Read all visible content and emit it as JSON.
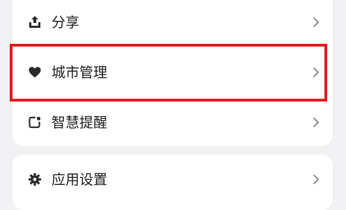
{
  "menu_group_1": {
    "items": [
      {
        "label": "分享",
        "icon": "share-icon"
      },
      {
        "label": "城市管理",
        "icon": "heart-icon"
      },
      {
        "label": "智慧提醒",
        "icon": "reminder-icon"
      }
    ]
  },
  "menu_group_2": {
    "items": [
      {
        "label": "应用设置",
        "icon": "gear-icon"
      }
    ]
  },
  "colors": {
    "highlight_border": "#e8161c",
    "background": "#f1f1f3",
    "card": "#ffffff",
    "text": "#1c1c1c",
    "chevron": "#777777"
  }
}
